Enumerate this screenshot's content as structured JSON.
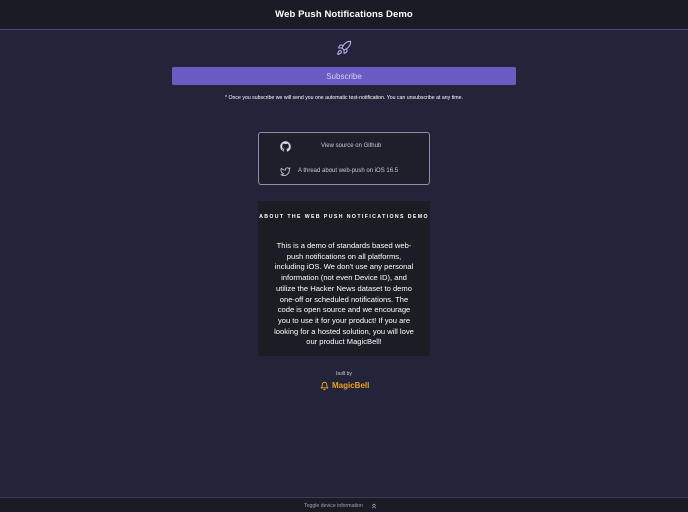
{
  "header": {
    "title": "Web Push Notifications Demo"
  },
  "hero": {
    "icon": "rocket-icon",
    "subscribe_label": "Subscribe",
    "notice": "* Once you subscribe we will send you one automatic test-notification. You can unsubscribe at any time."
  },
  "links": [
    {
      "icon": "github-icon",
      "label": "View source on Github"
    },
    {
      "icon": "twitter-icon",
      "label": "A thread about web-push on iOS 16.5"
    }
  ],
  "about": {
    "title": "ABOUT THE WEB PUSH NOTIFICATIONS DEMO",
    "body": "This is a demo of standards based web-push notifications on all platforms, including iOS. We don't use any personal information (not even Device ID), and utilize the Hacker News dataset to demo one-off or scheduled notifications. The code is open source and we encourage you to use it for your product! If you are looking for a hosted solution, you will love our product MagicBell!"
  },
  "branding": {
    "built_by": "built by",
    "name": "MagicBell",
    "color": "#f0a020"
  },
  "footer": {
    "toggle_label": "Toggle device information",
    "toggle_icon": "chevrons-up-icon"
  },
  "colors": {
    "background": "#23233a",
    "accent": "#6b5bc4"
  }
}
